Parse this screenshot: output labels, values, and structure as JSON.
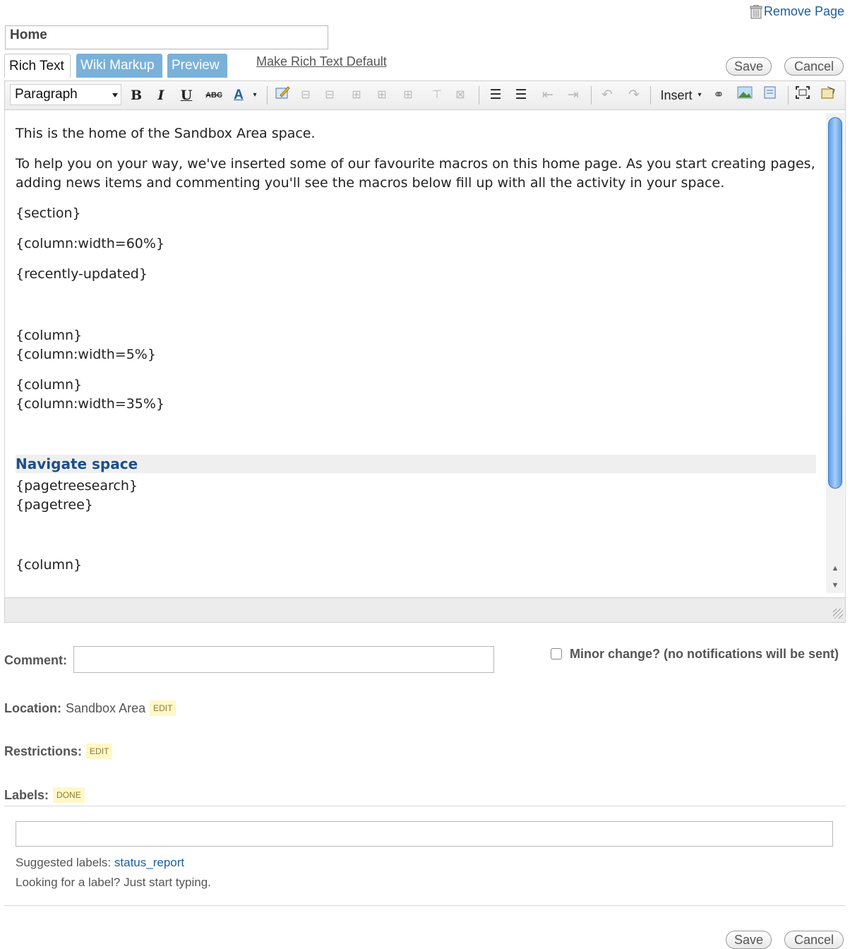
{
  "header": {
    "remove_page": "Remove Page",
    "title_value": "Home"
  },
  "tabs": {
    "rich_text": "Rich Text",
    "wiki_markup": "Wiki Markup",
    "preview": "Preview",
    "make_default": "Make Rich Text Default"
  },
  "actions": {
    "save": "Save",
    "cancel": "Cancel"
  },
  "toolbar": {
    "format_value": "Paragraph",
    "bold": "B",
    "italic": "I",
    "underline": "U",
    "strike": "ABC",
    "text_color": "A",
    "insert": "Insert",
    "icons": [
      "edit-table-icon",
      "insert-row-before-icon",
      "insert-row-after-icon",
      "insert-column-icon",
      "column-before-icon",
      "column-after-icon",
      "split-cell-icon",
      "delete-table-icon",
      "bullet-list-icon",
      "numbered-list-icon",
      "outdent-icon",
      "indent-icon",
      "undo-icon",
      "redo-icon",
      "link-icon",
      "image-icon",
      "macro-icon",
      "fullscreen-icon",
      "help-icon"
    ]
  },
  "editor": {
    "intro": "This is the home of the Sandbox Area space.",
    "para2": "To help you on your way, we've inserted some of our favourite macros on this home page. As you start creating pages, adding news items and commenting you'll see the macros below fill up with all the activity in your space.",
    "section": "{section}",
    "column_60": "{column:width=60%}",
    "recently_updated": "{recently-updated}",
    "column_end1": "{column}",
    "column_5": "{column:width=5%}",
    "column_end2": "{column}",
    "column_35": "{column:width=35%}",
    "nav_heading": "Navigate space",
    "pagetreesearch": "{pagetreesearch}",
    "pagetree": "{pagetree}",
    "column_end3": "{column}"
  },
  "form": {
    "comment_label": "Comment:",
    "minor_change": "Minor change? (no notifications will be sent)",
    "location_label": "Location:",
    "location_value": "Sandbox Area",
    "edit": "EDIT",
    "restrictions_label": "Restrictions:",
    "labels_label": "Labels:",
    "done": "DONE",
    "suggested_prefix": "Suggested labels:",
    "suggested_label": "status_report",
    "hint": "Looking for a label? Just start typing."
  }
}
